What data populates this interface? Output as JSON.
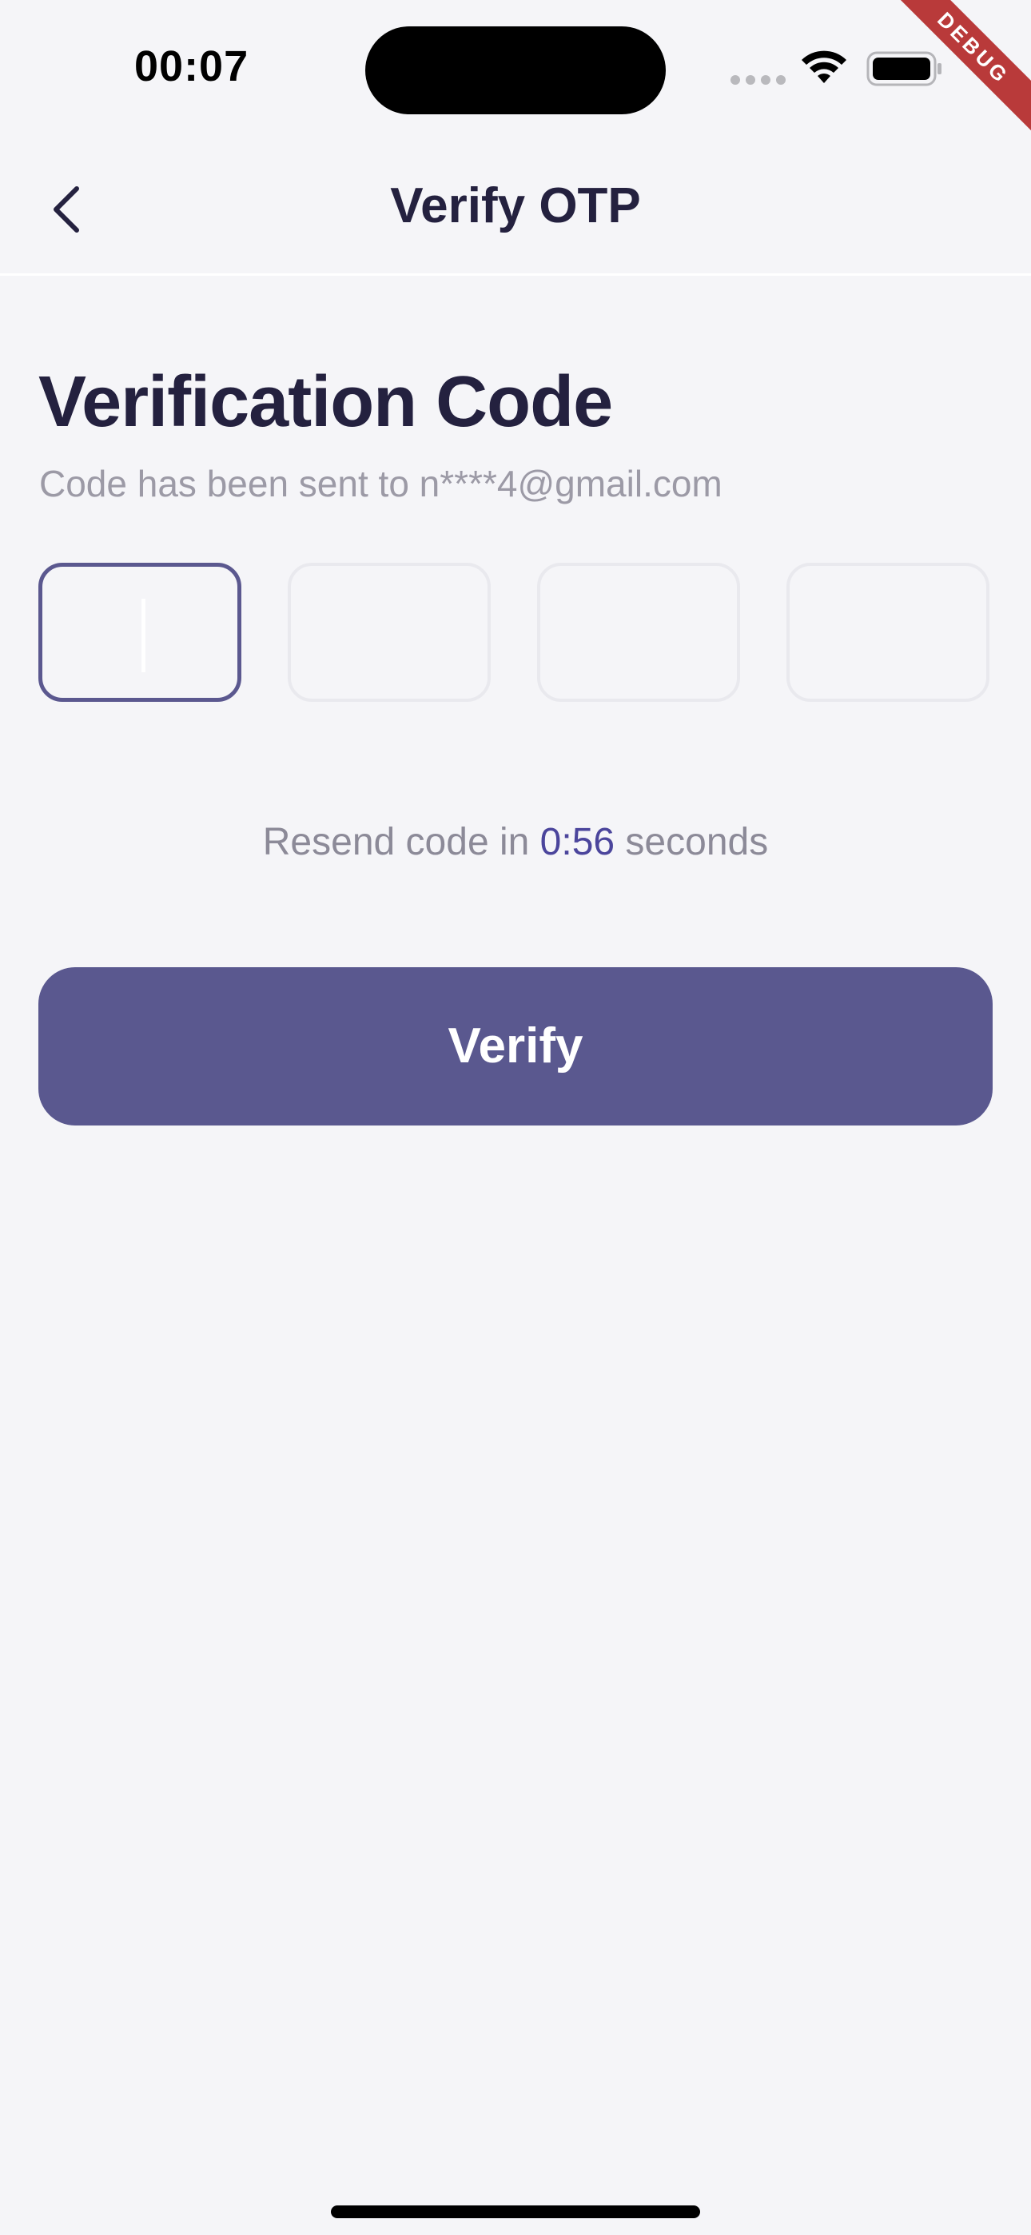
{
  "status_bar": {
    "time": "00:07"
  },
  "debug_banner": "DEBUG",
  "app_bar": {
    "title": "Verify OTP",
    "back_icon": "chevron-left-icon"
  },
  "content": {
    "heading": "Verification Code",
    "subtitle": "Code has been sent to n****4@gmail.com",
    "otp_fields": [
      {
        "value": "",
        "focused": true
      },
      {
        "value": "",
        "focused": false
      },
      {
        "value": "",
        "focused": false
      },
      {
        "value": "",
        "focused": false
      }
    ],
    "resend": {
      "prefix": "Resend code in ",
      "timer": "0:56",
      "suffix": " seconds"
    },
    "verify_button": "Verify"
  },
  "colors": {
    "background": "#f5f5f8",
    "title_text": "#24213f",
    "accent": "#5a588f",
    "timer": "#4b459c",
    "muted_text": "#9c9aa6",
    "debug_ribbon": "#b93a3a"
  }
}
